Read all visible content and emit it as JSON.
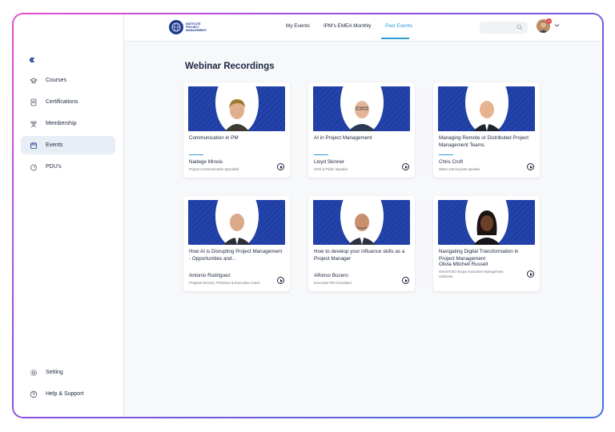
{
  "brand": {
    "logo_lines": [
      "INSTITUTE",
      "PROJECT",
      "MANAGEMENT"
    ]
  },
  "sidebar": {
    "collapse_icon": "double-chevron-left-icon",
    "items": [
      {
        "label": "Courses",
        "icon": "graduation-cap-icon",
        "active": false
      },
      {
        "label": "Certifications",
        "icon": "certificate-icon",
        "active": false
      },
      {
        "label": "Membership",
        "icon": "people-icon",
        "active": false
      },
      {
        "label": "Events",
        "icon": "calendar-icon",
        "active": true
      },
      {
        "label": "PDU's",
        "icon": "gauge-icon",
        "active": false
      }
    ],
    "bottom_items": [
      {
        "label": "Setting",
        "icon": "gear-icon"
      },
      {
        "label": "Help & Support",
        "icon": "help-icon"
      }
    ]
  },
  "topbar": {
    "tabs": [
      {
        "label": "My Events",
        "active": false
      },
      {
        "label": "IPM's EMEA Monthly",
        "active": false
      },
      {
        "label": "Past Events",
        "active": true
      }
    ],
    "notification_count": "2"
  },
  "main": {
    "title": "Webinar Recordings",
    "cards": [
      {
        "title": "Communication in PM",
        "speaker": "Nadege Minois",
        "role": "Project Communication Specialist"
      },
      {
        "title": "AI in Project Management",
        "speaker": "Lloyd Skinner",
        "role": "CEO & Public Speaker"
      },
      {
        "title": "Managing Remote or Distributed Project Management Teams",
        "speaker": "Chris Croft",
        "role": "Writer and Keynote speaker"
      },
      {
        "title": "How AI is Disrupting Project Management - Opportunities and...",
        "speaker": "Antonio Rodriguez",
        "role": "Program Director, Professor & Executive Coach"
      },
      {
        "title": "How to develop your influence skills as a Project Manager",
        "speaker": "Alfonso Bucero",
        "role": "Executive PM Consultant"
      },
      {
        "title": "Navigating Digital Transformation in Project Management",
        "speaker": "Olivia Mitchell Russell",
        "role": "Owner/CEO Exque Executive Management Solutions"
      }
    ]
  },
  "colors": {
    "brand_blue": "#1f3a93",
    "accent": "#2a9ad8",
    "frame_gradient": [
      "#e34fd0",
      "#3f6fe6"
    ]
  }
}
